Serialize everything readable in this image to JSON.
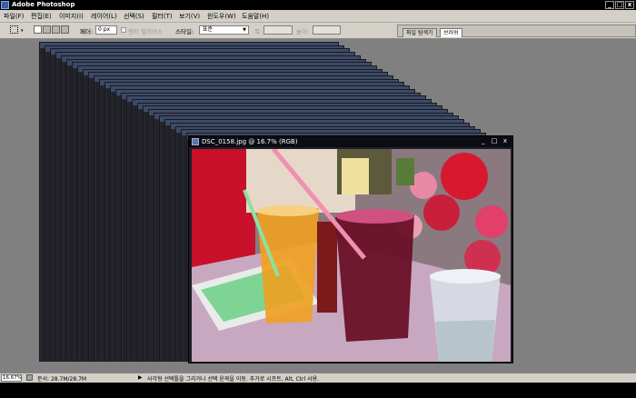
{
  "app": {
    "title": "Adobe Photoshop"
  },
  "window_buttons": [
    "_",
    "□",
    "x"
  ],
  "menu": [
    "파일(F)",
    "편집(E)",
    "이미지(I)",
    "레이어(L)",
    "선택(S)",
    "필터(T)",
    "보기(V)",
    "윈도우(W)",
    "도움말(H)"
  ],
  "options": {
    "feather_label": "페더:",
    "feather_value": "0 px",
    "antialias_label": "앤티 앨리어스",
    "style_label": "스타일:",
    "style_value": "표준",
    "width_label": "폭:",
    "height_label": "높이:"
  },
  "panel_tabs": [
    "파일 탐색기",
    "브러쉬"
  ],
  "document": {
    "title": "DSC_0158.jpg @ 16.7% (RGB)",
    "buttons": [
      "_",
      "□",
      "x"
    ]
  },
  "status": {
    "zoom": "16.67%",
    "doc_size": "문서: 28.7M/28.7M",
    "hint": "사각형 선택틀을 그리거나 선택 윤곽을 이동. 추가로 시프트, Alt, Ctrl 사용."
  }
}
